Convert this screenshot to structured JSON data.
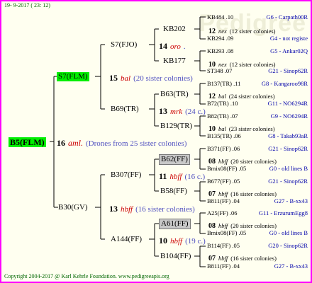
{
  "header": "19- 9-2017 ( 23: 12)",
  "footer": "Copyright 2004-2017 @ Karl Kehrle Foundation.   www.pedigreeapis.org",
  "watermark": "Pedigree",
  "colors": {
    "border": "#ff00ff",
    "highlight": "#00ee00",
    "gray": "#c8c8c8",
    "breed": "#cc0000",
    "sister": "#5050c0",
    "ref": "#0000aa",
    "copyright": "#006600"
  },
  "root": {
    "name": "B5(FLM)",
    "num": "16",
    "breed": "aml.",
    "note": "(Drones from 25 sister colonies)"
  },
  "gen1": [
    {
      "name": "S7(FLM)",
      "num": "15",
      "breed": "bal",
      "note": "(20 sister colonies)"
    },
    {
      "name": "B30(GV)",
      "num": "13",
      "breed": "hbff",
      "note": "(16 sister colonies)"
    }
  ],
  "gen2": [
    {
      "name": "S7(FJO)",
      "num": "14",
      "breed": "oro",
      "note": "."
    },
    {
      "name": "B69(TR)",
      "num": "13",
      "breed": "mrk",
      "note": "(24 c.)"
    },
    {
      "name": "B307(FF)",
      "num": "11",
      "breed": "hbff",
      "note": "(16 c.)"
    },
    {
      "name": "A144(FF)",
      "num": "10",
      "breed": "hbff",
      "note": "(19 c.)"
    }
  ],
  "gen3": [
    {
      "name": "KB202",
      "num": "12",
      "breed": "nex",
      "note": "(12 sister colonies)"
    },
    {
      "name": "KB177",
      "num": "10",
      "breed": "nex",
      "note": "(12 sister colonies)"
    },
    {
      "name": "B63(TR)",
      "num": "12",
      "breed": "bal",
      "note": "(24 sister colonies)"
    },
    {
      "name": "B129(TR)",
      "num": "10",
      "breed": "bal",
      "note": "(23 sister colonies)"
    },
    {
      "name": "B62(FF)",
      "num": "08",
      "breed": "hbff",
      "note": "(20 sister colonies)"
    },
    {
      "name": "B58(FF)",
      "num": "07",
      "breed": "hbff",
      "note": "(16 sister colonies)"
    },
    {
      "name": "A61(FF)",
      "num": "08",
      "breed": "hbff",
      "note": "(20 sister colonies)"
    },
    {
      "name": "B104(FF)",
      "num": "07",
      "breed": "hbff",
      "note": "(16 sister colonies)"
    }
  ],
  "gen4": [
    {
      "left": "KB484 .10",
      "right": "G6 - Carpath00R"
    },
    {
      "left": "KB294 .09",
      "right": "G4 - not registe"
    },
    {
      "left": "KB293 .08",
      "right": "G5 - Ankar02Q"
    },
    {
      "left": "ST348 .07",
      "right": "G21 - Sinop62R"
    },
    {
      "left": "B137(TR) .11",
      "right": "G8 - Kangaroo98R"
    },
    {
      "left": "B72(TR) .10",
      "right": "G11 - NO6294R"
    },
    {
      "left": "B82(TR) .07",
      "right": "G9 - NO6294R"
    },
    {
      "left": "B135(TR) .06",
      "right": "G8 - Takab93aR"
    },
    {
      "left": "B371(FF) .06",
      "right": "G21 - Sinop62R"
    },
    {
      "left": "Bmix08(FF) .05",
      "right": "G0 - old lines B"
    },
    {
      "left": "B677(FF) .05",
      "right": "G21 - Sinop62R"
    },
    {
      "left": "B811(FF) .04",
      "right": "G27 - B-xx43"
    },
    {
      "left": "A25(FF) .06",
      "right": "G11 - ErzurumEgg8"
    },
    {
      "left": "Bmix08(FF) .05",
      "right": "G0 - old lines B"
    },
    {
      "left": "B114(FF) .05",
      "right": "G20 - Sinop62R"
    },
    {
      "left": "B811(FF) .04",
      "right": "G27 - B-xx43"
    }
  ]
}
